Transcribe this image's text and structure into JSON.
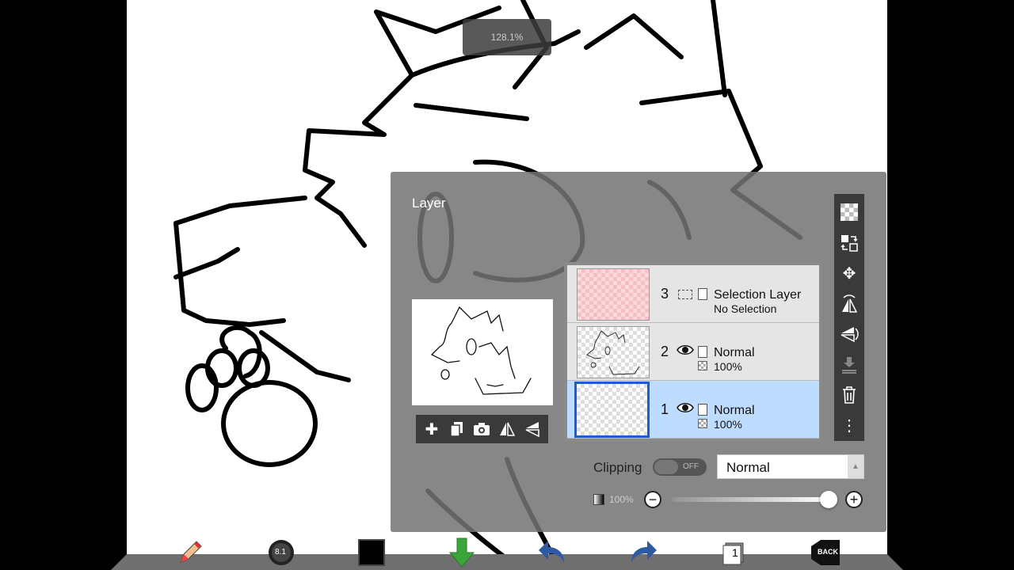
{
  "zoom": {
    "label": "128.1%"
  },
  "layer_panel": {
    "title": "Layer",
    "layers": [
      {
        "number": "3",
        "name": "Selection Layer",
        "sub": "No Selection",
        "selected": false
      },
      {
        "number": "2",
        "mode": "Normal",
        "opacity": "100%",
        "selected": false
      },
      {
        "number": "1",
        "mode": "Normal",
        "opacity": "100%",
        "selected": true
      }
    ],
    "clipping": {
      "label": "Clipping",
      "state": "OFF"
    },
    "blend_mode": "Normal",
    "opacity": {
      "label": "100%",
      "value": 1.0,
      "minus": "−",
      "plus": "+"
    }
  },
  "bottom_toolbar": {
    "brush_size": "8.1",
    "layer_count": "1",
    "back_label": "BACK"
  },
  "colors": {
    "primary": "#000000",
    "selection": "#bddcff",
    "accent": "#1a5fd0"
  }
}
